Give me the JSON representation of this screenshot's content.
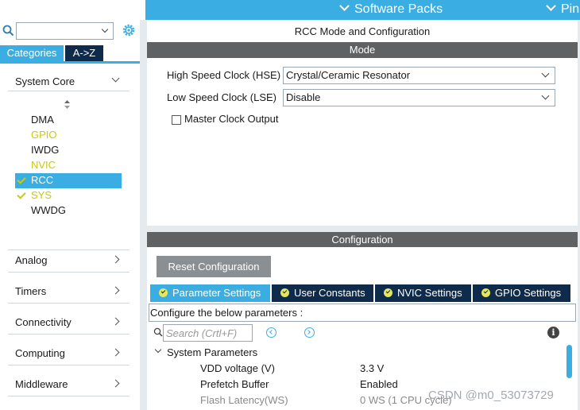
{
  "topbar": {
    "software_packs": "Software Packs",
    "pinout_partial": "Pin"
  },
  "left": {
    "search_placeholder": "",
    "tabs": [
      "Categories",
      "A->Z"
    ],
    "system_core": "System Core",
    "items": [
      {
        "label": "DMA",
        "state": "normal"
      },
      {
        "label": "GPIO",
        "state": "yellow"
      },
      {
        "label": "IWDG",
        "state": "normal"
      },
      {
        "label": "NVIC",
        "state": "yellow"
      },
      {
        "label": "RCC",
        "state": "selected-checked"
      },
      {
        "label": "SYS",
        "state": "checked-yellow"
      },
      {
        "label": "WWDG",
        "state": "normal"
      }
    ],
    "categories": [
      "Analog",
      "Timers",
      "Connectivity",
      "Computing",
      "Middleware"
    ]
  },
  "main": {
    "title": "RCC Mode and Configuration",
    "mode_header": "Mode",
    "hse_label": "High Speed Clock (HSE)",
    "hse_value": "Crystal/Ceramic Resonator",
    "lse_label": "Low Speed Clock (LSE)",
    "lse_value": "Disable",
    "mco_label": "Master Clock Output",
    "config_header": "Configuration",
    "reset_button": "Reset Configuration",
    "tabs": [
      "Parameter Settings",
      "User Constants",
      "NVIC Settings",
      "GPIO Settings"
    ],
    "configure_text": "Configure the below parameters :",
    "search_placeholder": "Search (Crtl+F)",
    "group": "System Parameters",
    "params": [
      {
        "name": "VDD voltage (V)",
        "value": "3.3 V"
      },
      {
        "name": "Prefetch Buffer",
        "value": "Enabled"
      },
      {
        "name": "Flash Latency(WS)",
        "value": "0 WS (1 CPU cycle)"
      }
    ]
  },
  "watermark": "CSDN @m0_53073729",
  "colors": {
    "accent": "#3aaee3",
    "navy": "#0e2b4c",
    "header": "#5f6163",
    "yellow": "#c9c90e"
  }
}
